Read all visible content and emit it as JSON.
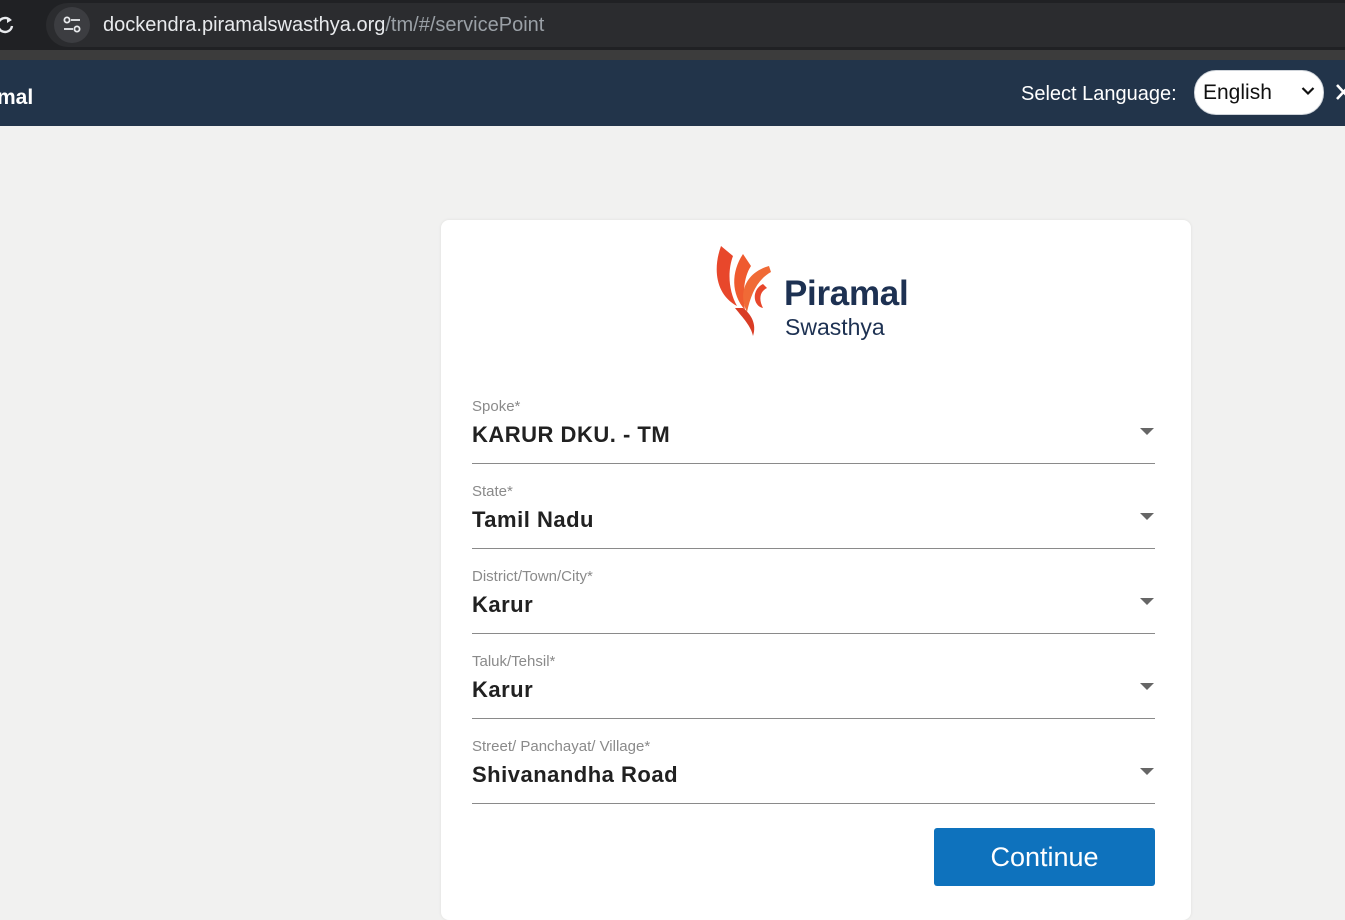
{
  "browser": {
    "url_host": "dockendra.piramalswasthya.org",
    "url_path": "/tm/#/servicePoint"
  },
  "header": {
    "brand": "mal",
    "language_label": "Select Language:",
    "language_value": "English"
  },
  "logo": {
    "name": "Piramal",
    "sub": "Swasthya",
    "brand_color": "#e8472b"
  },
  "form": {
    "fields": [
      {
        "label": "Spoke",
        "value": "KARUR DKU. - TM"
      },
      {
        "label": "State",
        "value": "Tamil Nadu"
      },
      {
        "label": "District/Town/City",
        "value": "Karur"
      },
      {
        "label": "Taluk/Tehsil",
        "value": "Karur"
      },
      {
        "label": "Street/ Panchayat/ Village",
        "value": "Shivanandha Road"
      }
    ],
    "required_marker": "*",
    "continue_label": "Continue"
  },
  "colors": {
    "header_bg": "#22344a",
    "button_bg": "#0e72bd",
    "page_bg": "#f1f1f0"
  }
}
